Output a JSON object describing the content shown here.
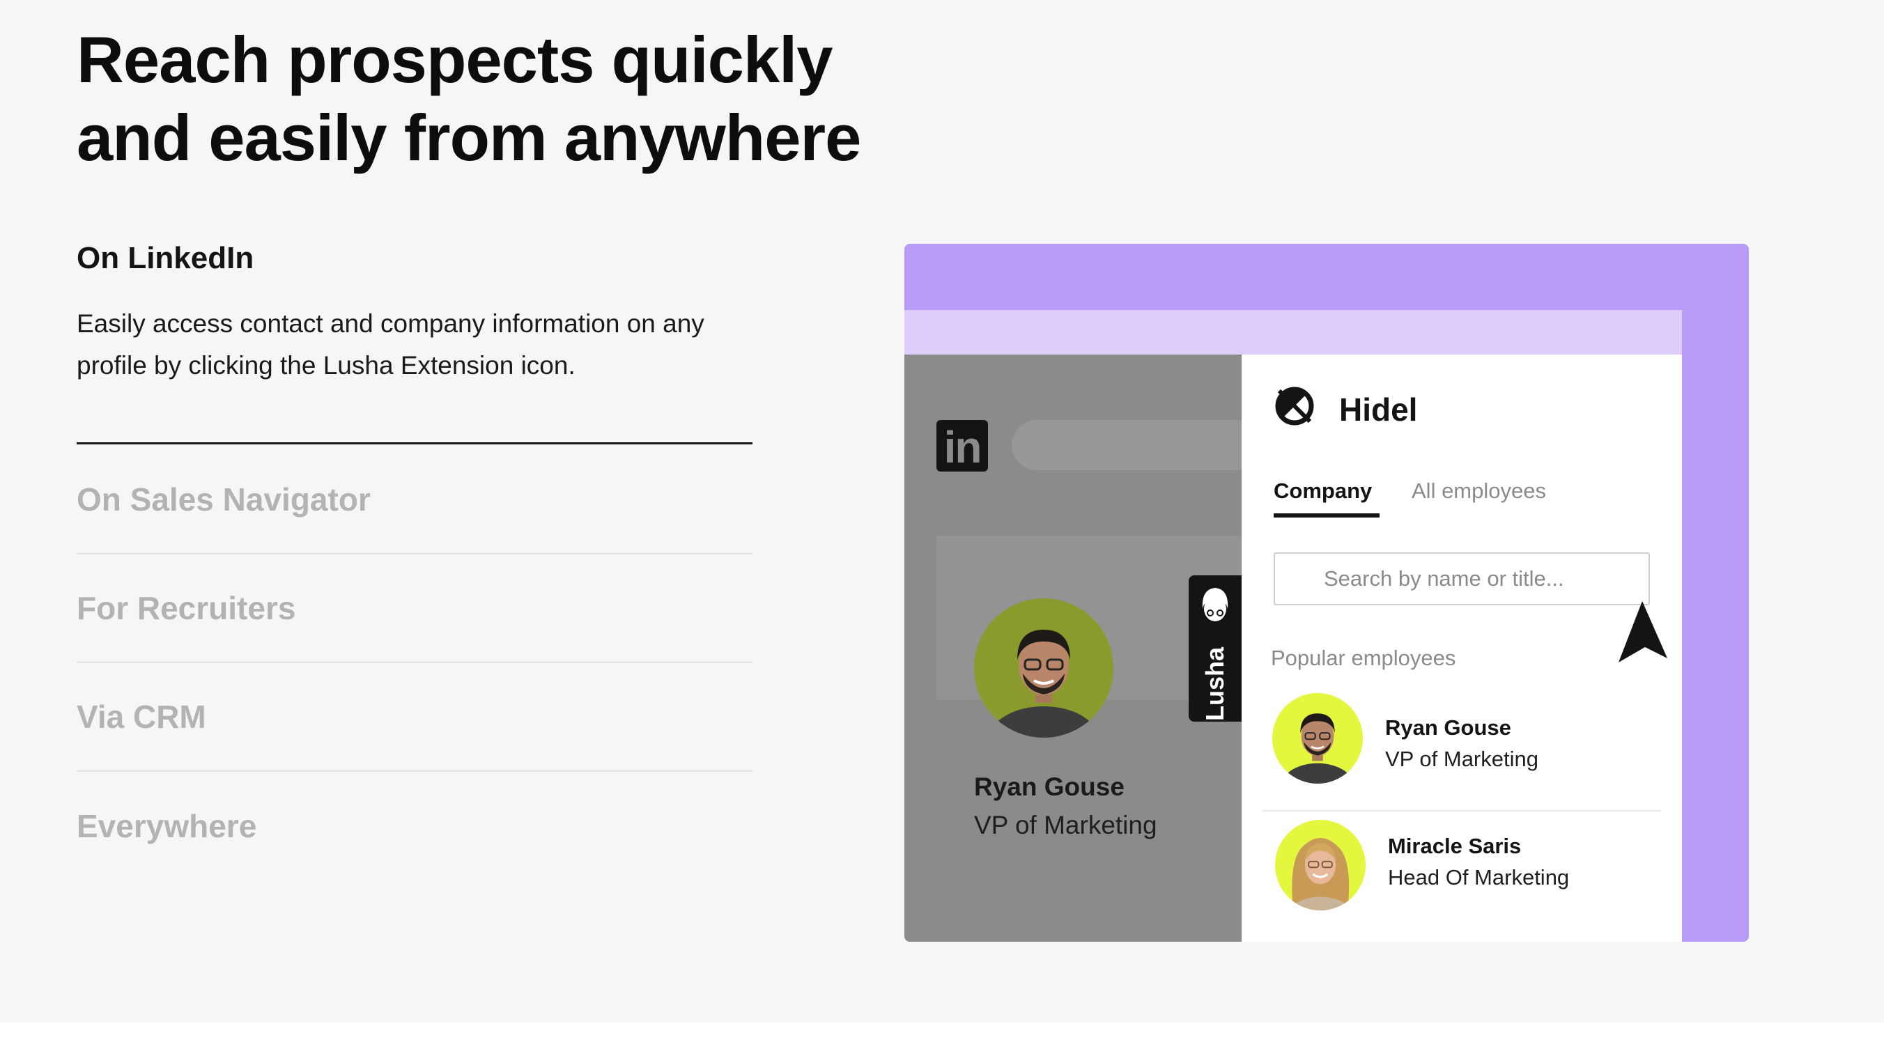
{
  "headline": {
    "line1": "Reach prospects quickly",
    "line2": "and easily from anywhere"
  },
  "active_feature": {
    "title": "On LinkedIn",
    "description": "Easily access contact and company information on any profile by clicking the Lusha Extension icon."
  },
  "features": [
    {
      "label": "On Sales Navigator"
    },
    {
      "label": "For Recruiters"
    },
    {
      "label": "Via CRM"
    },
    {
      "label": "Everywhere"
    }
  ],
  "illustration": {
    "linkedin": {
      "logo_text": "in",
      "profile_name": "Ryan Gouse",
      "profile_role": "VP of Marketing"
    },
    "lusha_tab": "Lusha",
    "panel": {
      "company_name": "Hidel",
      "tabs": [
        {
          "label": "Company"
        },
        {
          "label": "All employees"
        }
      ],
      "search_placeholder": "Search by name or title...",
      "popular_label": "Popular employees",
      "employees": [
        {
          "name": "Ryan Gouse",
          "role": "VP of Marketing"
        },
        {
          "name": "Miracle Saris",
          "role": "Head Of Marketing"
        }
      ]
    }
  },
  "colors": {
    "frame_purple": "#b89bf6",
    "browser_bar": "#ddcdfb",
    "avatar_lime": "#e4f73f",
    "linkedin_gray": "#8b8b8b"
  }
}
